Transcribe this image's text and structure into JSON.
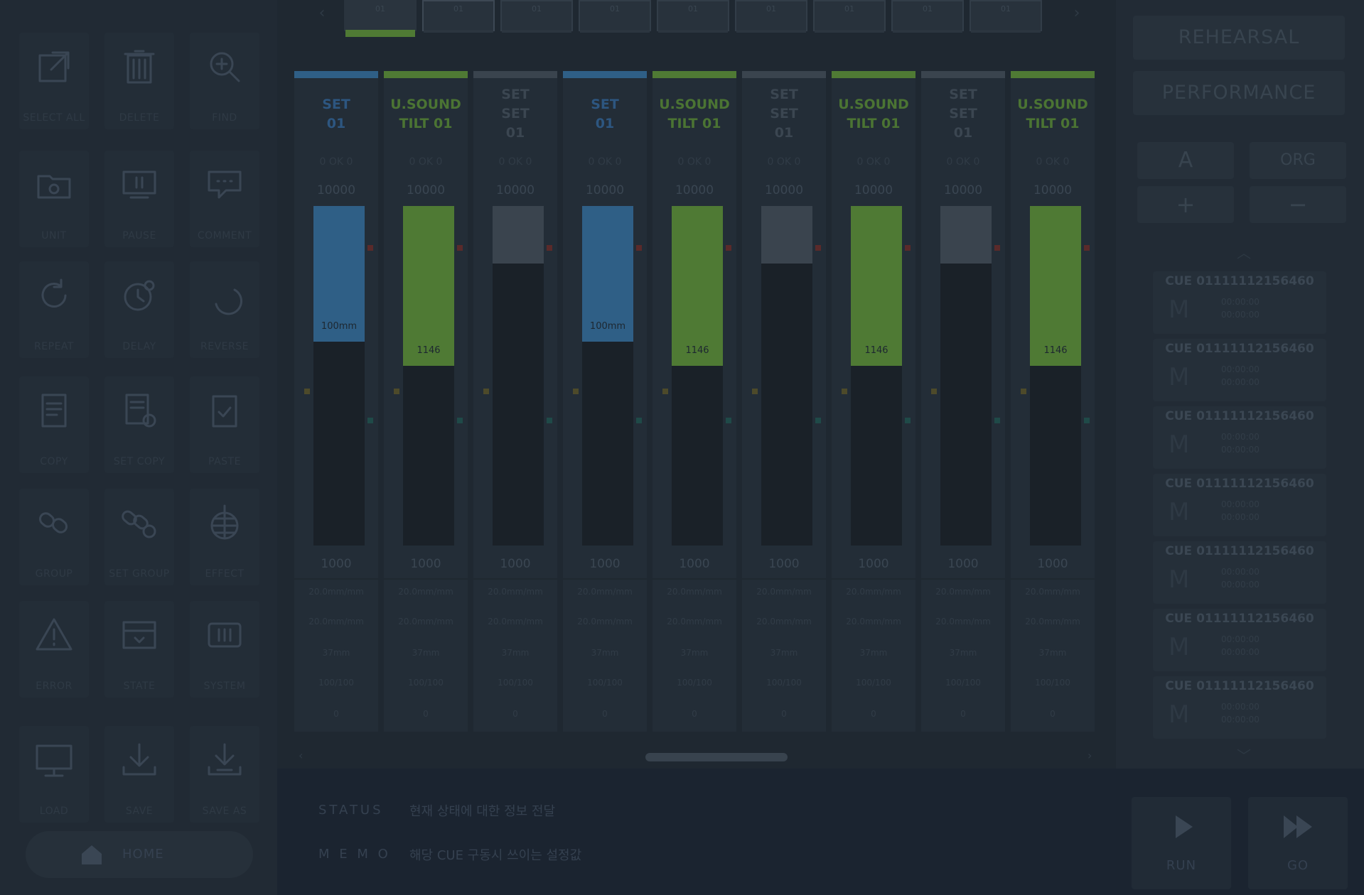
{
  "tabs": {
    "items": [
      "01",
      "01",
      "01",
      "01",
      "01",
      "01",
      "01",
      "01",
      "01"
    ],
    "active_index": 0,
    "selected_index": 1,
    "active_color": "#4f7a34"
  },
  "tools": [
    {
      "name": "select-all",
      "label": "SELECT ALL",
      "icon": "external-link-icon"
    },
    {
      "name": "delete",
      "label": "DELETE",
      "icon": "trash-icon"
    },
    {
      "name": "find",
      "label": "FIND",
      "icon": "search-icon"
    },
    {
      "name": "unit",
      "label": "UNIT",
      "icon": "folder-icon"
    },
    {
      "name": "pause",
      "label": "PAUSE",
      "icon": "monitor-pause-icon"
    },
    {
      "name": "comment",
      "label": "COMMENT",
      "icon": "chat-bubble-icon"
    },
    {
      "name": "repeat",
      "label": "REPEAT",
      "icon": "repeat-icon"
    },
    {
      "name": "delay",
      "label": "DELAY",
      "icon": "clock-icon"
    },
    {
      "name": "reverse",
      "label": "REVERSE",
      "icon": "reverse-icon"
    },
    {
      "name": "copy",
      "label": "COPY",
      "icon": "document-icon"
    },
    {
      "name": "set-copy",
      "label": "SET COPY",
      "icon": "document-copy-icon"
    },
    {
      "name": "paste",
      "label": "PASTE",
      "icon": "paste-icon"
    },
    {
      "name": "group",
      "label": "GROUP",
      "icon": "link-icon"
    },
    {
      "name": "set-group",
      "label": "SET GROUP",
      "icon": "link-group-icon"
    },
    {
      "name": "effect",
      "label": "EFFECT",
      "icon": "disco-ball-icon"
    },
    {
      "name": "error",
      "label": "ERROR",
      "icon": "warning-icon"
    },
    {
      "name": "state",
      "label": "STATE",
      "icon": "state-icon"
    },
    {
      "name": "system",
      "label": "SYSTEM",
      "icon": "system-icon"
    },
    {
      "name": "load",
      "label": "LOAD",
      "icon": "monitor-icon"
    },
    {
      "name": "save",
      "label": "SAVE",
      "icon": "download-icon"
    },
    {
      "name": "save-as",
      "label": "SAVE AS",
      "icon": "download-as-icon"
    }
  ],
  "home": {
    "label": "HOME",
    "icon": "home-icon"
  },
  "colors": {
    "blue": "#2f5f86",
    "green": "#4f7a34",
    "gray": "#3a444e",
    "blue_text": "#2d5680",
    "green_text": "#4b7433",
    "gray_text": "#3b4651"
  },
  "channels": [
    {
      "name": [
        "SET",
        "01"
      ],
      "type": "blue",
      "ok": "0 OK 0",
      "max": "10000",
      "min": "1000",
      "fill": 0.4,
      "fill_label": "100mm",
      "rows": [
        "20.0mm/mm",
        "20.0mm/mm",
        "37mm",
        "100/100",
        "0"
      ]
    },
    {
      "name": [
        "U.SOUND",
        "TILT 01"
      ],
      "type": "green",
      "ok": "0 OK 0",
      "max": "10000",
      "min": "1000",
      "fill": 0.47,
      "fill_label": "1146",
      "rows": [
        "20.0mm/mm",
        "20.0mm/mm",
        "37mm",
        "100/100",
        "0"
      ]
    },
    {
      "name": [
        "SET",
        "SET",
        "01"
      ],
      "type": "gray",
      "ok": "0 OK 0",
      "max": "10000",
      "min": "1000",
      "fill": 0.17,
      "fill_label": "",
      "rows": [
        "20.0mm/mm",
        "20.0mm/mm",
        "37mm",
        "100/100",
        "0"
      ]
    },
    {
      "name": [
        "SET",
        "01"
      ],
      "type": "blue",
      "ok": "0 OK 0",
      "max": "10000",
      "min": "1000",
      "fill": 0.4,
      "fill_label": "100mm",
      "rows": [
        "20.0mm/mm",
        "20.0mm/mm",
        "37mm",
        "100/100",
        "0"
      ]
    },
    {
      "name": [
        "U.SOUND",
        "TILT 01"
      ],
      "type": "green",
      "ok": "0 OK 0",
      "max": "10000",
      "min": "1000",
      "fill": 0.47,
      "fill_label": "1146",
      "rows": [
        "20.0mm/mm",
        "20.0mm/mm",
        "37mm",
        "100/100",
        "0"
      ]
    },
    {
      "name": [
        "SET",
        "SET",
        "01"
      ],
      "type": "gray",
      "ok": "0 OK 0",
      "max": "10000",
      "min": "1000",
      "fill": 0.17,
      "fill_label": "",
      "rows": [
        "20.0mm/mm",
        "20.0mm/mm",
        "37mm",
        "100/100",
        "0"
      ]
    },
    {
      "name": [
        "U.SOUND",
        "TILT 01"
      ],
      "type": "green",
      "ok": "0 OK 0",
      "max": "10000",
      "min": "1000",
      "fill": 0.47,
      "fill_label": "1146",
      "rows": [
        "20.0mm/mm",
        "20.0mm/mm",
        "37mm",
        "100/100",
        "0"
      ]
    },
    {
      "name": [
        "SET",
        "SET",
        "01"
      ],
      "type": "gray",
      "ok": "0 OK 0",
      "max": "10000",
      "min": "1000",
      "fill": 0.17,
      "fill_label": "",
      "rows": [
        "20.0mm/mm",
        "20.0mm/mm",
        "37mm",
        "100/100",
        "0"
      ]
    },
    {
      "name": [
        "U.SOUND",
        "TILT 01"
      ],
      "type": "green",
      "ok": "0 OK 0",
      "max": "10000",
      "min": "1000",
      "fill": 0.47,
      "fill_label": "1146",
      "rows": [
        "20.0mm/mm",
        "20.0mm/mm",
        "37mm",
        "100/100",
        "0"
      ]
    }
  ],
  "right": {
    "rehearsal": "REHEARSAL",
    "performance": "PERFORMANCE",
    "controls": [
      "A",
      "ORG",
      "+",
      "−"
    ],
    "cues": [
      {
        "title": "CUE 01111112156460",
        "mark": "M",
        "t1": "00:00:00",
        "t2": "00:00:00"
      },
      {
        "title": "CUE 01111112156460",
        "mark": "M",
        "t1": "00:00:00",
        "t2": "00:00:00"
      },
      {
        "title": "CUE 01111112156460",
        "mark": "M",
        "t1": "00:00:00",
        "t2": "00:00:00"
      },
      {
        "title": "CUE 01111112156460",
        "mark": "M",
        "t1": "00:00:00",
        "t2": "00:00:00"
      },
      {
        "title": "CUE 01111112156460",
        "mark": "M",
        "t1": "00:00:00",
        "t2": "00:00:00"
      },
      {
        "title": "CUE 01111112156460",
        "mark": "M",
        "t1": "00:00:00",
        "t2": "00:00:00"
      },
      {
        "title": "CUE 01111112156460",
        "mark": "M",
        "t1": "00:00:00",
        "t2": "00:00:00"
      }
    ]
  },
  "bottom": {
    "status_label": "STATUS",
    "status_value": "현재 상태에 대한 정보 전달",
    "memo_label": "M E M O",
    "memo_value": "해당 CUE 구동시 쓰이는 설정값",
    "run": "RUN",
    "go": "GO"
  }
}
